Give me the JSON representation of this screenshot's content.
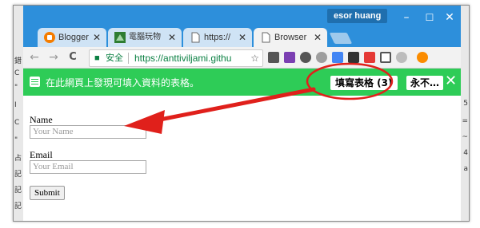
{
  "colors": {
    "titlebar": "#2d8fdb",
    "infobar": "#2ecc57",
    "annotation": "#e0201b",
    "omnibox_green": "#0b8043"
  },
  "profile": {
    "name": "esor huang"
  },
  "window_controls": {
    "minimize": "–",
    "maximize": "☐",
    "close": "✕"
  },
  "tabs": [
    {
      "label": "Blogger",
      "icon": "blogger-icon",
      "close": "✕"
    },
    {
      "label": "電腦玩物",
      "icon": "site-icon",
      "close": "✕"
    },
    {
      "label": "https://",
      "icon": "page-icon",
      "close": "✕"
    },
    {
      "label": "Browser",
      "icon": "page-icon",
      "close": "✕",
      "active": true
    }
  ],
  "toolbar": {
    "back": "←",
    "forward": "→",
    "reload": "C",
    "secure_label": "安全",
    "url": "https://anttiviljami.githu",
    "star": "☆",
    "extensions": [
      "evernote-icon",
      "onenote-icon",
      "pocket-icon",
      "chrome-icon",
      "translate-icon",
      "film-icon",
      "red-icon",
      "cast-icon",
      "gray-icon",
      "orange-icon"
    ]
  },
  "infobar": {
    "message": "在此網頁上發現可填入資料的表格。",
    "fill_button": "填寫表格 (3)",
    "never_button": "永不…",
    "close": "✕"
  },
  "form": {
    "name_label": "Name",
    "name_placeholder": "Your Name",
    "email_label": "Email",
    "email_placeholder": "Your Email",
    "submit_label": "Submit"
  },
  "background_windows": {
    "left_chars": [
      "錯",
      "C",
      "\"",
      "I",
      "C",
      "\"",
      "占",
      "記",
      "記",
      "記"
    ],
    "right_chars": [
      "5",
      "=",
      "~",
      "4",
      "a"
    ]
  }
}
